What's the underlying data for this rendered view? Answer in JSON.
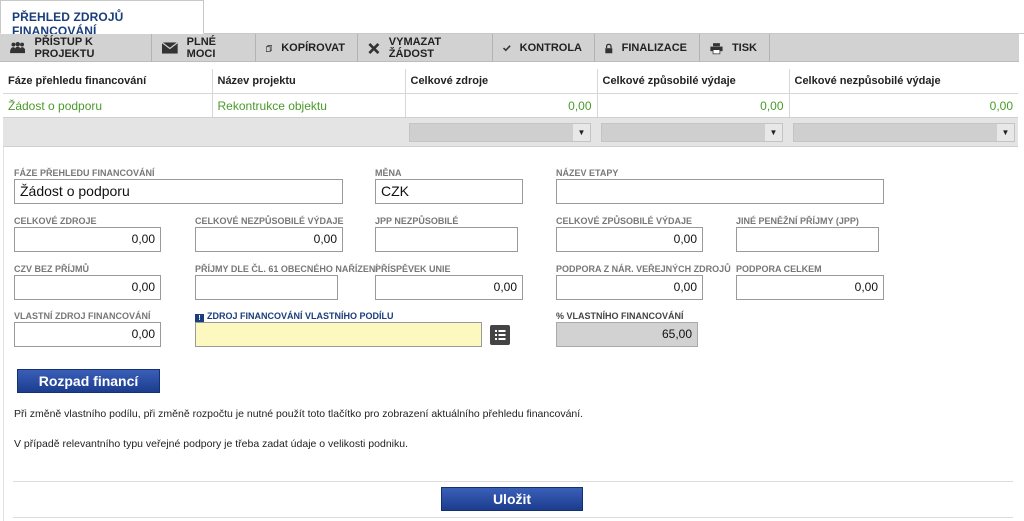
{
  "tab": {
    "label": "PŘEHLED ZDROJŮ FINANCOVÁNÍ"
  },
  "toolbar": {
    "items": [
      {
        "label": "PŘÍSTUP K PROJEKTU",
        "icon": "people-icon"
      },
      {
        "label": "PLNÉ MOCI",
        "icon": "envelope-icon"
      },
      {
        "label": "KOPÍROVAT",
        "icon": "copy-icon"
      },
      {
        "label": "VYMAZAT ŽÁDOST",
        "icon": "x-icon"
      },
      {
        "label": "KONTROLA",
        "icon": "checkmark-icon"
      },
      {
        "label": "FINALIZACE",
        "icon": "lock-icon"
      },
      {
        "label": "TISK",
        "icon": "printer-icon"
      }
    ]
  },
  "grid": {
    "headers": [
      "Fáze přehledu financování",
      "Název projektu",
      "Celkové zdroje",
      "Celkové způsobilé výdaje",
      "Celkové nezpůsobilé výdaje"
    ],
    "row": [
      "Žádost o podporu",
      "Rekontrukce objektu",
      "0,00",
      "0,00",
      "0,00"
    ]
  },
  "form": {
    "faze_label": "FÁZE PŘEHLEDU FINANCOVÁNÍ",
    "faze_value": "Žádost o podporu",
    "mena_label": "MĚNA",
    "mena_value": "CZK",
    "nazev_etapy_label": "NÁZEV ETAPY",
    "nazev_etapy_value": "",
    "celkove_zdroje_label": "CELKOVÉ ZDROJE",
    "celkove_zdroje_value": "0,00",
    "celkove_nezpusobile_label": "CELKOVÉ NEZPŮSOBILÉ VÝDAJE",
    "celkove_nezpusobile_value": "0,00",
    "jpp_nezpusobile_label": "JPP NEZPŮSOBILÉ",
    "jpp_nezpusobile_value": "",
    "celkove_zpusobile_label": "CELKOVÉ ZPŮSOBILÉ VÝDAJE",
    "celkove_zpusobile_value": "0,00",
    "jine_prijmy_label": "JINÉ PENĚŽNÍ PŘÍJMY (JPP)",
    "jine_prijmy_value": "",
    "czv_label": "CZV BEZ PŘÍJMŮ",
    "czv_value": "0,00",
    "prijmy61_label": "PŘÍJMY DLE ČL. 61 OBECNÉHO NAŘÍZENÍ",
    "prijmy61_value": "",
    "prispevek_label": "PŘÍSPĚVEK UNIE",
    "prispevek_value": "0,00",
    "podpora_nar_label": "PODPORA Z NÁR. VEŘEJNÝCH ZDROJŮ",
    "podpora_nar_value": "0,00",
    "podpora_celkem_label": "PODPORA CELKEM",
    "podpora_celkem_value": "0,00",
    "vlastni_label": "VLASTNÍ ZDROJ FINANCOVÁNÍ",
    "vlastni_value": "0,00",
    "zdroj_vlastniho_label": "ZDROJ FINANCOVÁNÍ VLASTNÍHO PODÍLU",
    "zdroj_vlastniho_value": "",
    "procento_label": "% VLASTNÍHO FINANCOVÁNÍ",
    "procento_value": "65,00"
  },
  "buttons": {
    "rozpad": "Rozpad financí",
    "ulozit": "Uložit"
  },
  "notes": {
    "n1": "Při změně vlastního podílu, při změně rozpočtu je nutné použít toto tlačítko pro zobrazení aktuálního přehledu financování.",
    "n2": "V případě relevantního typu veřejné podpory je třeba zadat údaje o velikosti podniku."
  },
  "colors": {
    "accent": "#1a3d7c",
    "green_link": "#4a9a2a",
    "required_bg": "#fdf7c0"
  }
}
